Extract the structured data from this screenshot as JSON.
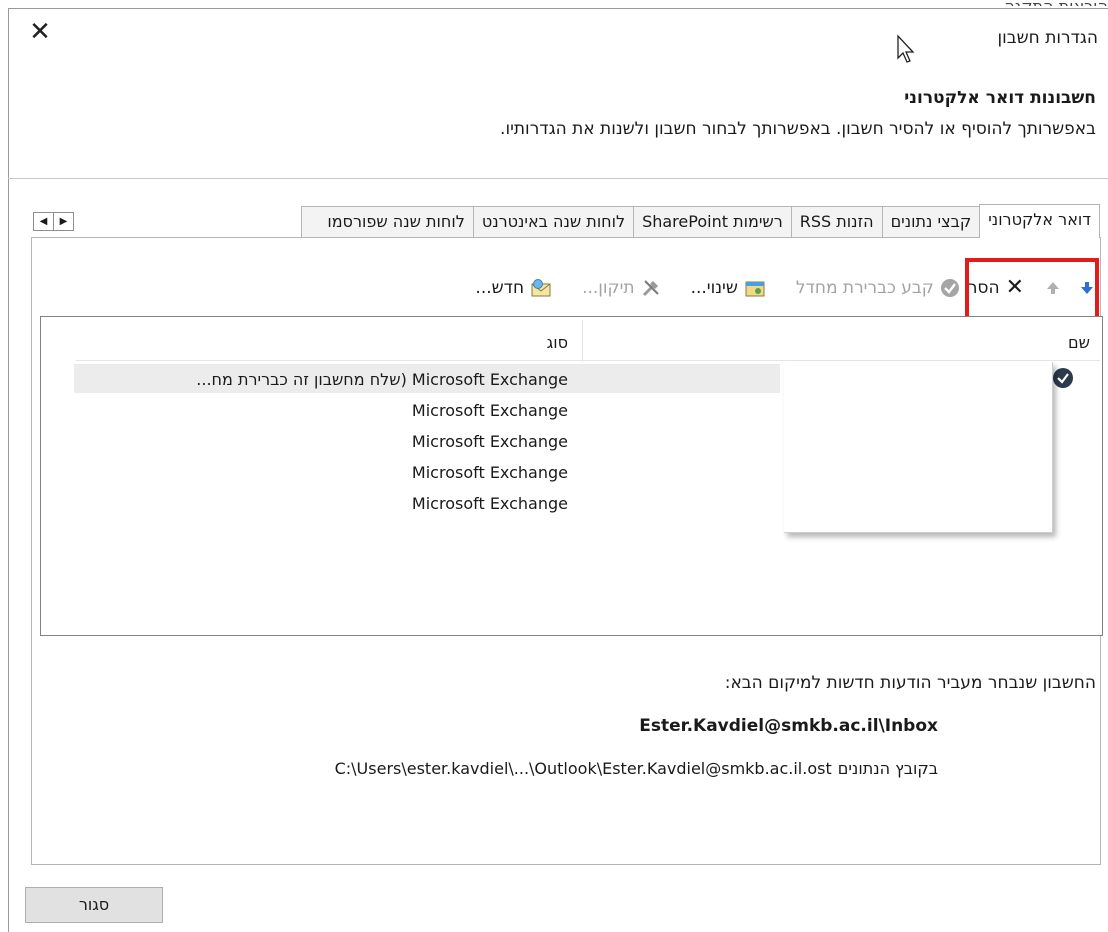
{
  "window": {
    "title": "הגדרות חשבון",
    "top_strip_text": "הוראות התקנה"
  },
  "header": {
    "heading": "חשבונות דואר אלקטרוני",
    "subheading": "באפשרותך להוסיף או להסיר חשבון. באפשרותך לבחור חשבון ולשנות את הגדרותיו."
  },
  "tabs": [
    {
      "label": "דואר אלקטרוני",
      "active": true
    },
    {
      "label": "קבצי נתונים",
      "active": false
    },
    {
      "label": "הזנות RSS",
      "active": false
    },
    {
      "label": "רשימות SharePoint",
      "active": false
    },
    {
      "label": "לוחות שנה באינטרנט",
      "active": false
    },
    {
      "label": "לוחות שנה שפורסמו",
      "active": false
    }
  ],
  "toolbar": {
    "new_label": "חדש...",
    "repair_label": "תיקון...",
    "change_label": "שינוי...",
    "set_default_label": "קבע כברירת מחדל",
    "remove_label": "הסר"
  },
  "accounts_list": {
    "columns": [
      "שם",
      "סוג"
    ],
    "rows": [
      "Microsoft Exchange (שלח מחשבון זה כברירת מח...",
      "Microsoft Exchange",
      "Microsoft Exchange",
      "Microsoft Exchange",
      "Microsoft Exchange"
    ]
  },
  "delivery": {
    "info_line": "החשבון שנבחר מעביר הודעות חדשות למיקום הבא:",
    "mailbox": "Ester.Kavdiel@smkb.ac.il\\Inbox",
    "datafile_prefix": "בקובץ הנתונים",
    "datafile_path": "C:\\Users\\ester.kavdiel\\...\\Outlook\\Ester.Kavdiel@smkb.ac.il.ost"
  },
  "footer": {
    "close_label": "סגור"
  },
  "colors": {
    "highlight": "#e41b1b",
    "selected_row": "#ececec"
  }
}
